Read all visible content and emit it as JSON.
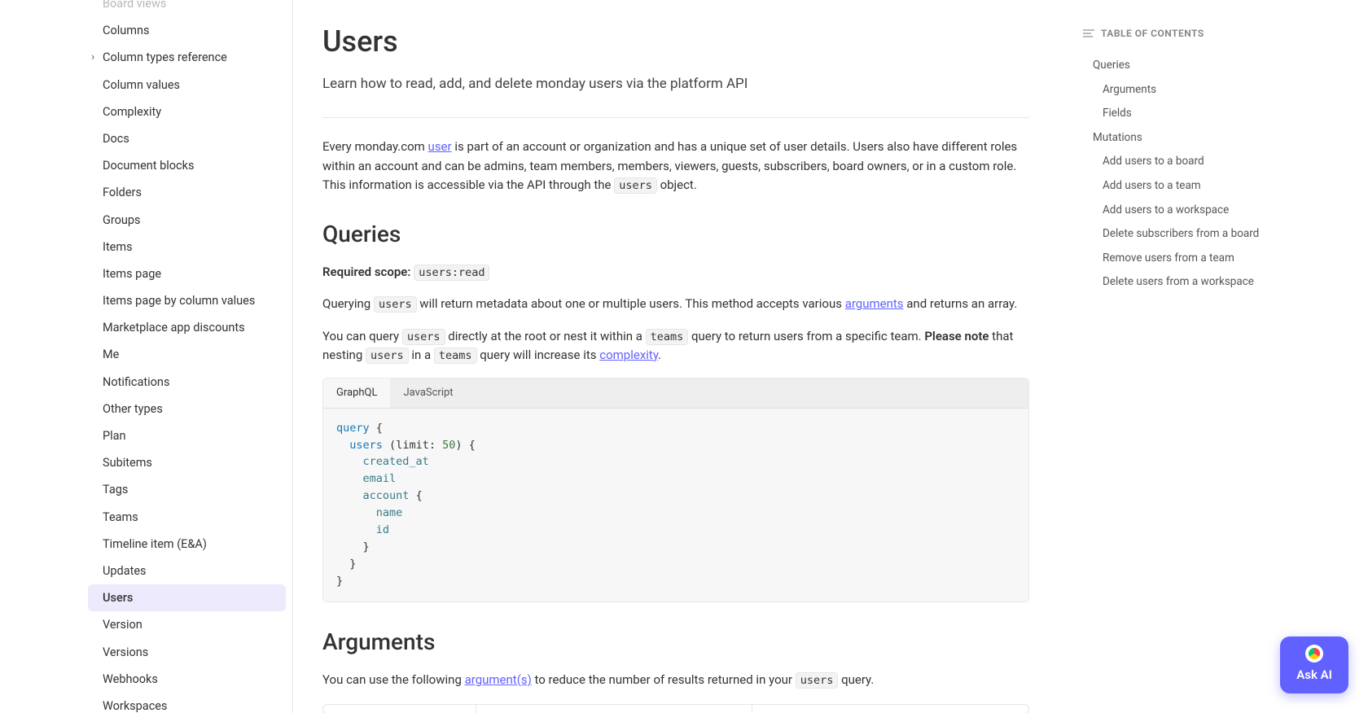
{
  "sidebar": {
    "items": [
      {
        "label": "Board views",
        "chevron": false,
        "active": false
      },
      {
        "label": "Columns",
        "chevron": false,
        "active": false
      },
      {
        "label": "Column types reference",
        "chevron": true,
        "active": false
      },
      {
        "label": "Column values",
        "chevron": false,
        "active": false
      },
      {
        "label": "Complexity",
        "chevron": false,
        "active": false
      },
      {
        "label": "Docs",
        "chevron": false,
        "active": false
      },
      {
        "label": "Document blocks",
        "chevron": false,
        "active": false
      },
      {
        "label": "Folders",
        "chevron": false,
        "active": false
      },
      {
        "label": "Groups",
        "chevron": false,
        "active": false
      },
      {
        "label": "Items",
        "chevron": false,
        "active": false
      },
      {
        "label": "Items page",
        "chevron": false,
        "active": false
      },
      {
        "label": "Items page by column values",
        "chevron": false,
        "active": false
      },
      {
        "label": "Marketplace app discounts",
        "chevron": false,
        "active": false
      },
      {
        "label": "Me",
        "chevron": false,
        "active": false
      },
      {
        "label": "Notifications",
        "chevron": false,
        "active": false
      },
      {
        "label": "Other types",
        "chevron": false,
        "active": false
      },
      {
        "label": "Plan",
        "chevron": false,
        "active": false
      },
      {
        "label": "Subitems",
        "chevron": false,
        "active": false
      },
      {
        "label": "Tags",
        "chevron": false,
        "active": false
      },
      {
        "label": "Teams",
        "chevron": false,
        "active": false
      },
      {
        "label": "Timeline item (E&A)",
        "chevron": false,
        "active": false
      },
      {
        "label": "Updates",
        "chevron": false,
        "active": false
      },
      {
        "label": "Users",
        "chevron": false,
        "active": true
      },
      {
        "label": "Version",
        "chevron": false,
        "active": false
      },
      {
        "label": "Versions",
        "chevron": false,
        "active": false
      },
      {
        "label": "Webhooks",
        "chevron": false,
        "active": false
      },
      {
        "label": "Workspaces",
        "chevron": false,
        "active": false
      }
    ]
  },
  "page": {
    "title": "Users",
    "subtitle": "Learn how to read, add, and delete monday users via the platform API",
    "intro": {
      "pre_link": "Every monday.com ",
      "link_text": "user",
      "post_link": " is part of an account or organization and has a unique set of user details. Users also have different roles within an account and can be admins, team members, members, viewers, guests, subscribers, board owners, or in a custom role. This information is accessible via the API through the ",
      "code": "users",
      "tail": " object."
    },
    "queries": {
      "heading": "Queries",
      "scope_label": "Required scope:",
      "scope_code": "users:read",
      "p1": {
        "pre": "Querying ",
        "code1": "users",
        "mid": " will return metadata about one or multiple users. This method accepts various ",
        "link": "arguments",
        "post": " and returns an array."
      },
      "p2": {
        "pre": "You can query ",
        "code1": "users",
        "mid1": " directly at the root or nest it within a ",
        "code2": "teams",
        "mid2": " query to return users from a specific team. ",
        "bold": "Please note",
        "mid3": " that nesting ",
        "code3": "users",
        "mid4": " in a ",
        "code4": "teams",
        "mid5": " query will increase its ",
        "link": "complexity",
        "post": "."
      }
    },
    "code": {
      "tabs": [
        "GraphQL",
        "JavaScript"
      ],
      "active_tab": 0,
      "tokens": {
        "kw_query": "query",
        "field_users": "users",
        "arg_limit": "limit",
        "num_50": "50",
        "field_created_at": "created_at",
        "field_email": "email",
        "field_account": "account",
        "field_name": "name",
        "field_id": "id"
      }
    },
    "arguments": {
      "heading": "Arguments",
      "p": {
        "pre": "You can use the following ",
        "link": "argument(s)",
        "mid": " to reduce the number of results returned in your ",
        "code": "users",
        "post": " query."
      }
    }
  },
  "toc": {
    "title": "TABLE OF CONTENTS",
    "items": [
      {
        "label": "Queries",
        "level": 1
      },
      {
        "label": "Arguments",
        "level": 2
      },
      {
        "label": "Fields",
        "level": 2
      },
      {
        "label": "Mutations",
        "level": 1
      },
      {
        "label": "Add users to a board",
        "level": 2
      },
      {
        "label": "Add users to a team",
        "level": 2
      },
      {
        "label": "Add users to a workspace",
        "level": 2
      },
      {
        "label": "Delete subscribers from a board",
        "level": 2
      },
      {
        "label": "Remove users from a team",
        "level": 2
      },
      {
        "label": "Delete users from a workspace",
        "level": 2
      }
    ]
  },
  "ask_ai": {
    "label": "Ask AI"
  }
}
